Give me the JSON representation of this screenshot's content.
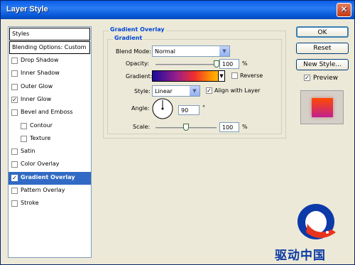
{
  "window": {
    "title": "Layer Style",
    "close_glyph": "✕"
  },
  "left_panel": {
    "header_styles": "Styles",
    "header_blending": "Blending Options: Custom",
    "items": [
      {
        "label": "Drop Shadow",
        "checked": false
      },
      {
        "label": "Inner Shadow",
        "checked": false
      },
      {
        "label": "Outer Glow",
        "checked": false
      },
      {
        "label": "Inner Glow",
        "checked": true
      },
      {
        "label": "Bevel and Emboss",
        "checked": false
      },
      {
        "label": "Contour",
        "checked": false
      },
      {
        "label": "Texture",
        "checked": false
      },
      {
        "label": "Satin",
        "checked": false
      },
      {
        "label": "Color Overlay",
        "checked": false
      },
      {
        "label": "Gradient Overlay",
        "checked": true,
        "selected": true
      },
      {
        "label": "Pattern Overlay",
        "checked": false
      },
      {
        "label": "Stroke",
        "checked": false
      }
    ],
    "check_mark": "✓"
  },
  "panel": {
    "outer_title": "Gradient Overlay",
    "inner_title": "Gradient",
    "blend_mode_label": "Blend Mode:",
    "blend_mode_value": "Normal",
    "opacity_label": "Opacity:",
    "opacity_value": "100",
    "opacity_fraction": 1.0,
    "percent": "%",
    "gradient_label": "Gradient:",
    "reverse_label": "Reverse",
    "reverse_checked": false,
    "style_label": "Style:",
    "style_value": "Linear",
    "align_label": "Align with Layer",
    "align_checked": true,
    "angle_label": "Angle:",
    "angle_value": "90",
    "degree": "°",
    "scale_label": "Scale:",
    "scale_value": "100",
    "scale_fraction": 0.5,
    "dropdown_glyph": "▼"
  },
  "buttons": {
    "ok": "OK",
    "reset": "Reset",
    "new_style": "New Style..."
  },
  "preview": {
    "label": "Preview",
    "checked": true
  },
  "watermark": "驱动中国"
}
